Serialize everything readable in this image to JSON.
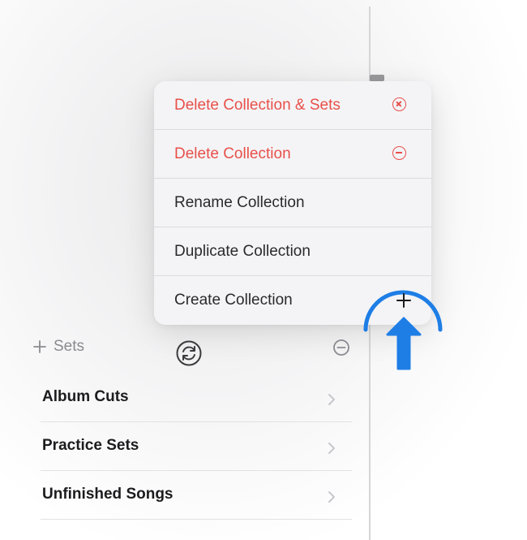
{
  "context_menu": {
    "items": [
      {
        "label": "Delete Collection & Sets",
        "destructive": true,
        "icon": "circle-x-icon"
      },
      {
        "label": "Delete Collection",
        "destructive": true,
        "icon": "circle-minus-icon"
      },
      {
        "label": "Rename Collection",
        "destructive": false
      },
      {
        "label": "Duplicate Collection",
        "destructive": false
      },
      {
        "label": "Create Collection",
        "destructive": false
      }
    ]
  },
  "add_button": {
    "icon": "plus-icon"
  },
  "annotation": {
    "icon": "arrow-up-icon",
    "color": "#1e7ee6"
  },
  "toolbar": {
    "add_sets_label": "Sets",
    "add_sets_icon": "plus-icon",
    "sync_icon": "sync-icon",
    "remove_icon": "circle-minus-icon"
  },
  "list": {
    "items": [
      {
        "name": "Album Cuts"
      },
      {
        "name": "Practice Sets"
      },
      {
        "name": "Unfinished Songs"
      }
    ]
  },
  "colors": {
    "destructive": "#e8504a",
    "accent_annotation": "#1e7ee6",
    "secondary_text": "#8a8a90"
  }
}
